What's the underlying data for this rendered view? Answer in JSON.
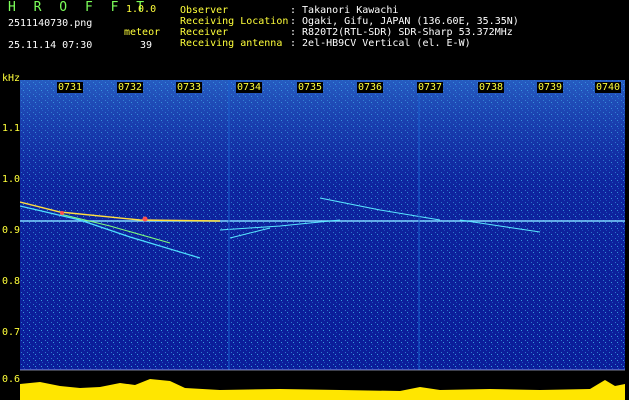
{
  "app": {
    "title": "H R O F F T",
    "version": "1.0.0"
  },
  "file": {
    "name": "2511140730.png",
    "datetime": "25.11.14 07:30"
  },
  "meteor": {
    "label": "meteor",
    "count": "39"
  },
  "observer": {
    "rows": [
      {
        "label": "Observer",
        "value": ": Takanori Kawachi"
      },
      {
        "label": "Receiving Location",
        "value": ": Ogaki, Gifu, JAPAN (136.60E, 35.35N)"
      },
      {
        "label": "Receiver",
        "value": ": R820T2(RTL-SDR) SDR-Sharp 53.372MHz"
      },
      {
        "label": "Receiving antenna",
        "value": ": 2el-HB9CV Vertical (el. E-W)"
      }
    ]
  },
  "axis": {
    "unit": "kHz",
    "ticks": [
      "1.1",
      "1.0",
      "0.9",
      "0.8",
      "0.7",
      "0.6"
    ]
  },
  "time_marks": [
    "0731",
    "0732",
    "0733",
    "0734",
    "0735",
    "0736",
    "0737",
    "0738",
    "0739",
    "0740"
  ],
  "colors": {
    "background": "#0a1a8c",
    "label_green": "#7cff5a",
    "label_yellow": "#ffff3a",
    "amplitude": "#ffe600"
  }
}
